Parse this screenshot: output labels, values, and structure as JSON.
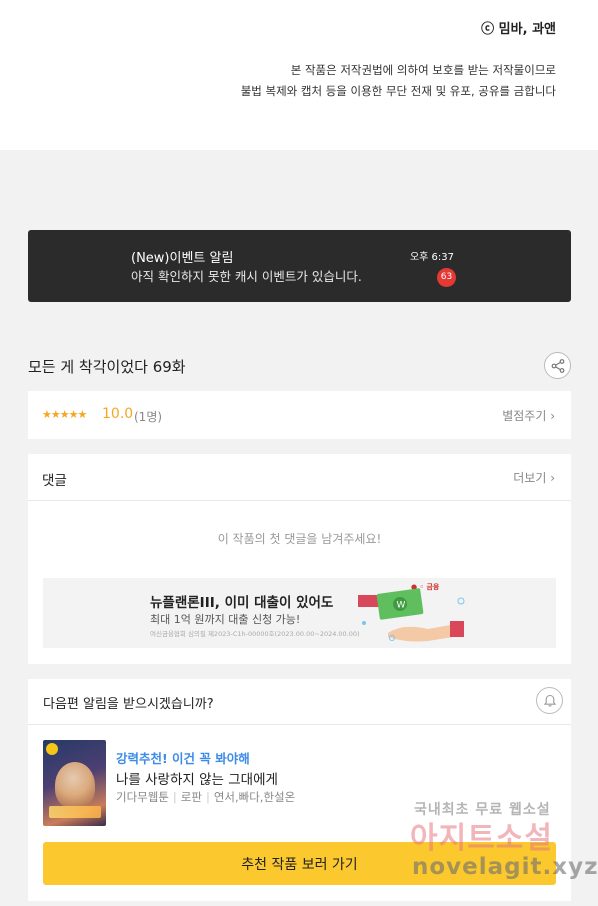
{
  "header": {
    "cut_text": "· · · · ·",
    "copyright": "ⓒ 밈바, 과앤",
    "notice_line1": "본 작품은 저작권법에 의하여 보호를 받는 저작물이므로",
    "notice_line2": "불법 복제와 캡처 등을 이용한 무단 전재 및 유포, 공유를 금합니다"
  },
  "event": {
    "title": "(New)이벤트 알림",
    "body": "아직 확인하지 못한 캐시 이벤트가 있습니다.",
    "time": "오후 6:37",
    "badge": "63"
  },
  "episode": {
    "title": "모든 게 착각이었다 69화",
    "share_icon": "share-icon"
  },
  "rating": {
    "stars": "★★★★★",
    "score": "10.0",
    "count": "(1명)",
    "rate_link": "별점주기 ›"
  },
  "comments": {
    "title": "댓글",
    "more": "더보기 ›",
    "empty": "이 작품의 첫 댓글을 남겨주세요!"
  },
  "ad": {
    "title": "뉴플랜론III, 이미 대출이 있어도",
    "subtitle": "최대 1억 원까지 대출 신청 가능!",
    "fine_print": "여신금융협회 심의필 제2023-C1h-00000호(2023.00.00~2024.00.00)",
    "brand": "● ◦ 금융"
  },
  "next_episode": {
    "question": "다음편 알림을 받으시겠습니까?",
    "bell_icon": "bell-icon",
    "recommend_label": "강력추천! 이건 꼭 봐야해",
    "recommend_title": "나를 사랑하지 않는 그대에게",
    "meta": [
      "기다무웹툰",
      "로판",
      "연서,빠다,한설온"
    ],
    "button": "추천 작품 보러 가기"
  },
  "watermark": {
    "line1": "국내최초 무료 웹소설",
    "line2": "아지트소설",
    "line3": "novelagit.xyz"
  },
  "colors": {
    "accent_yellow": "#fbc82e",
    "star_orange": "#f5a623",
    "badge_red": "#e53935",
    "link_blue": "#3d8be8",
    "event_bg": "#2b2b2b"
  }
}
